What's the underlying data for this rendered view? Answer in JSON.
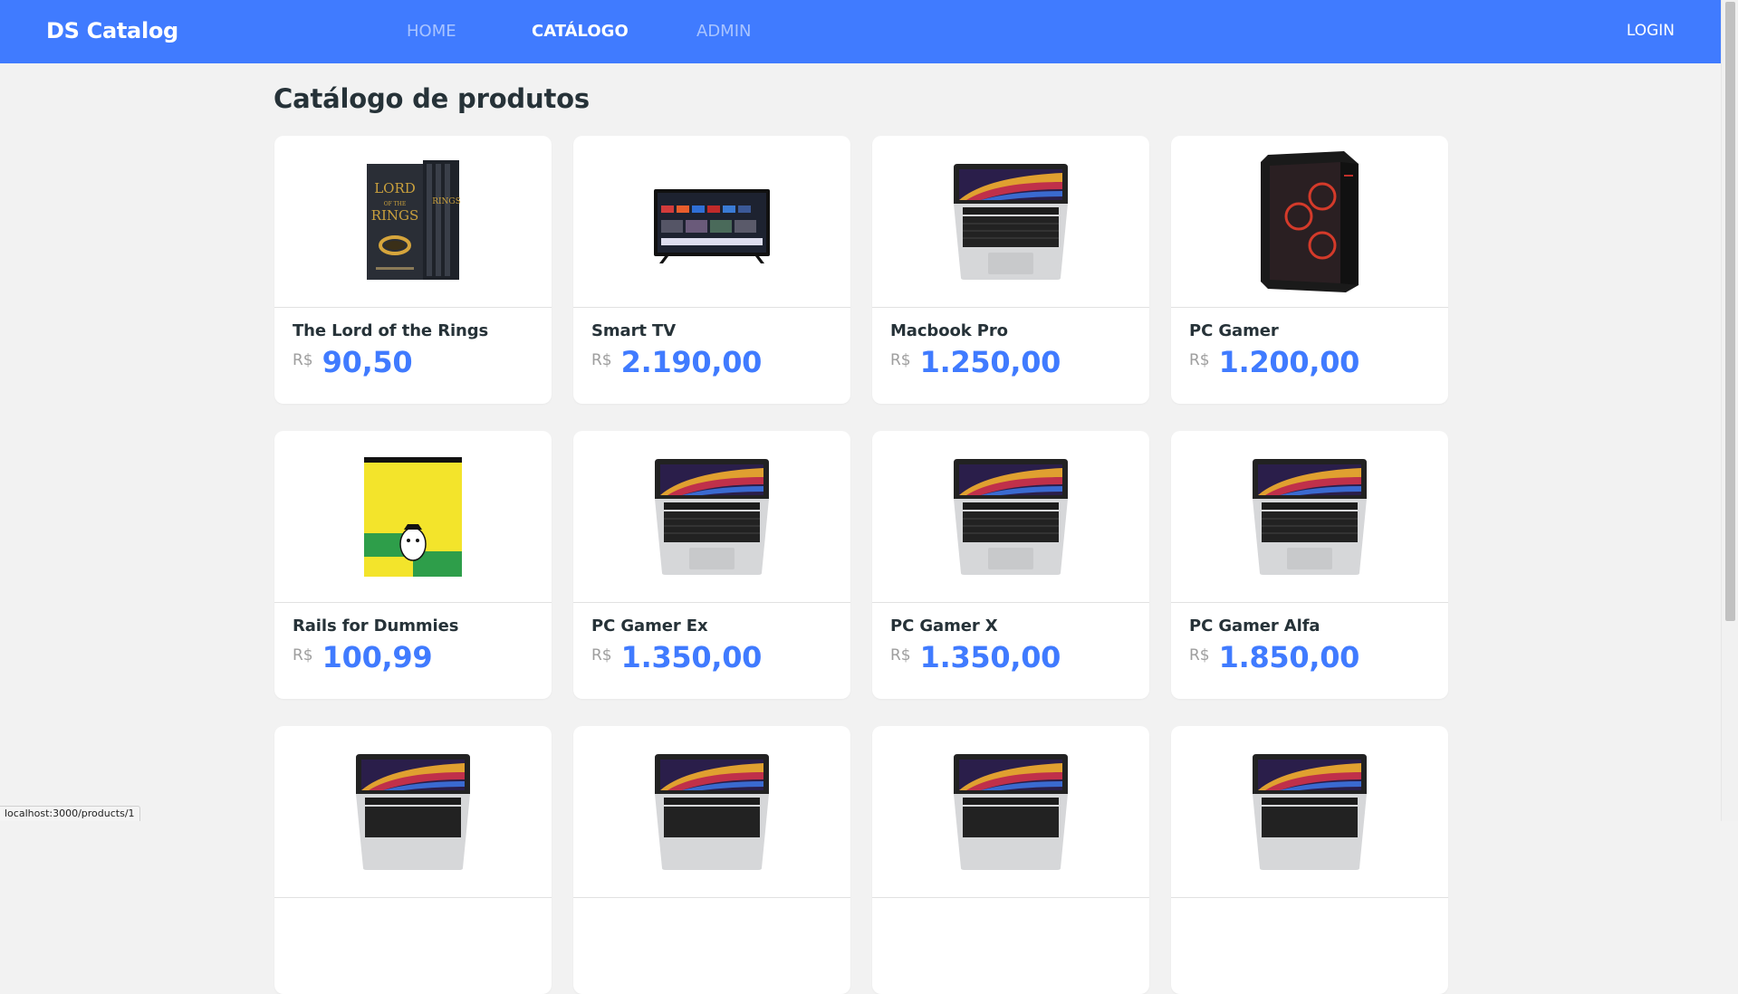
{
  "navbar": {
    "brand": "DS Catalog",
    "links": [
      {
        "label": "HOME",
        "active": false
      },
      {
        "label": "CATÁLOGO",
        "active": true
      },
      {
        "label": "ADMIN",
        "active": false
      }
    ],
    "login": "LOGIN"
  },
  "main": {
    "title": "Catálogo de produtos",
    "products": [
      {
        "name": "The Lord of the Rings",
        "currency": "R$",
        "price": "90,50",
        "image": "lotr-box-set"
      },
      {
        "name": "Smart TV",
        "currency": "R$",
        "price": "2.190,00",
        "image": "smart-tv"
      },
      {
        "name": "Macbook Pro",
        "currency": "R$",
        "price": "1.250,00",
        "image": "laptop"
      },
      {
        "name": "PC Gamer",
        "currency": "R$",
        "price": "1.200,00",
        "image": "pc-case"
      },
      {
        "name": "Rails for Dummies",
        "currency": "R$",
        "price": "100,99",
        "image": "dummies-book"
      },
      {
        "name": "PC Gamer Ex",
        "currency": "R$",
        "price": "1.350,00",
        "image": "laptop"
      },
      {
        "name": "PC Gamer X",
        "currency": "R$",
        "price": "1.350,00",
        "image": "laptop"
      },
      {
        "name": "PC Gamer Alfa",
        "currency": "R$",
        "price": "1.850,00",
        "image": "laptop"
      },
      {
        "name": "",
        "currency": "",
        "price": "",
        "image": "laptop"
      },
      {
        "name": "",
        "currency": "",
        "price": "",
        "image": "laptop"
      },
      {
        "name": "",
        "currency": "",
        "price": "",
        "image": "laptop"
      },
      {
        "name": "",
        "currency": "",
        "price": "",
        "image": "laptop"
      }
    ]
  },
  "status_bar": {
    "url": "localhost:3000/products/1"
  },
  "colors": {
    "primary": "#407bff",
    "background": "#f2f2f2",
    "text": "#263238"
  }
}
